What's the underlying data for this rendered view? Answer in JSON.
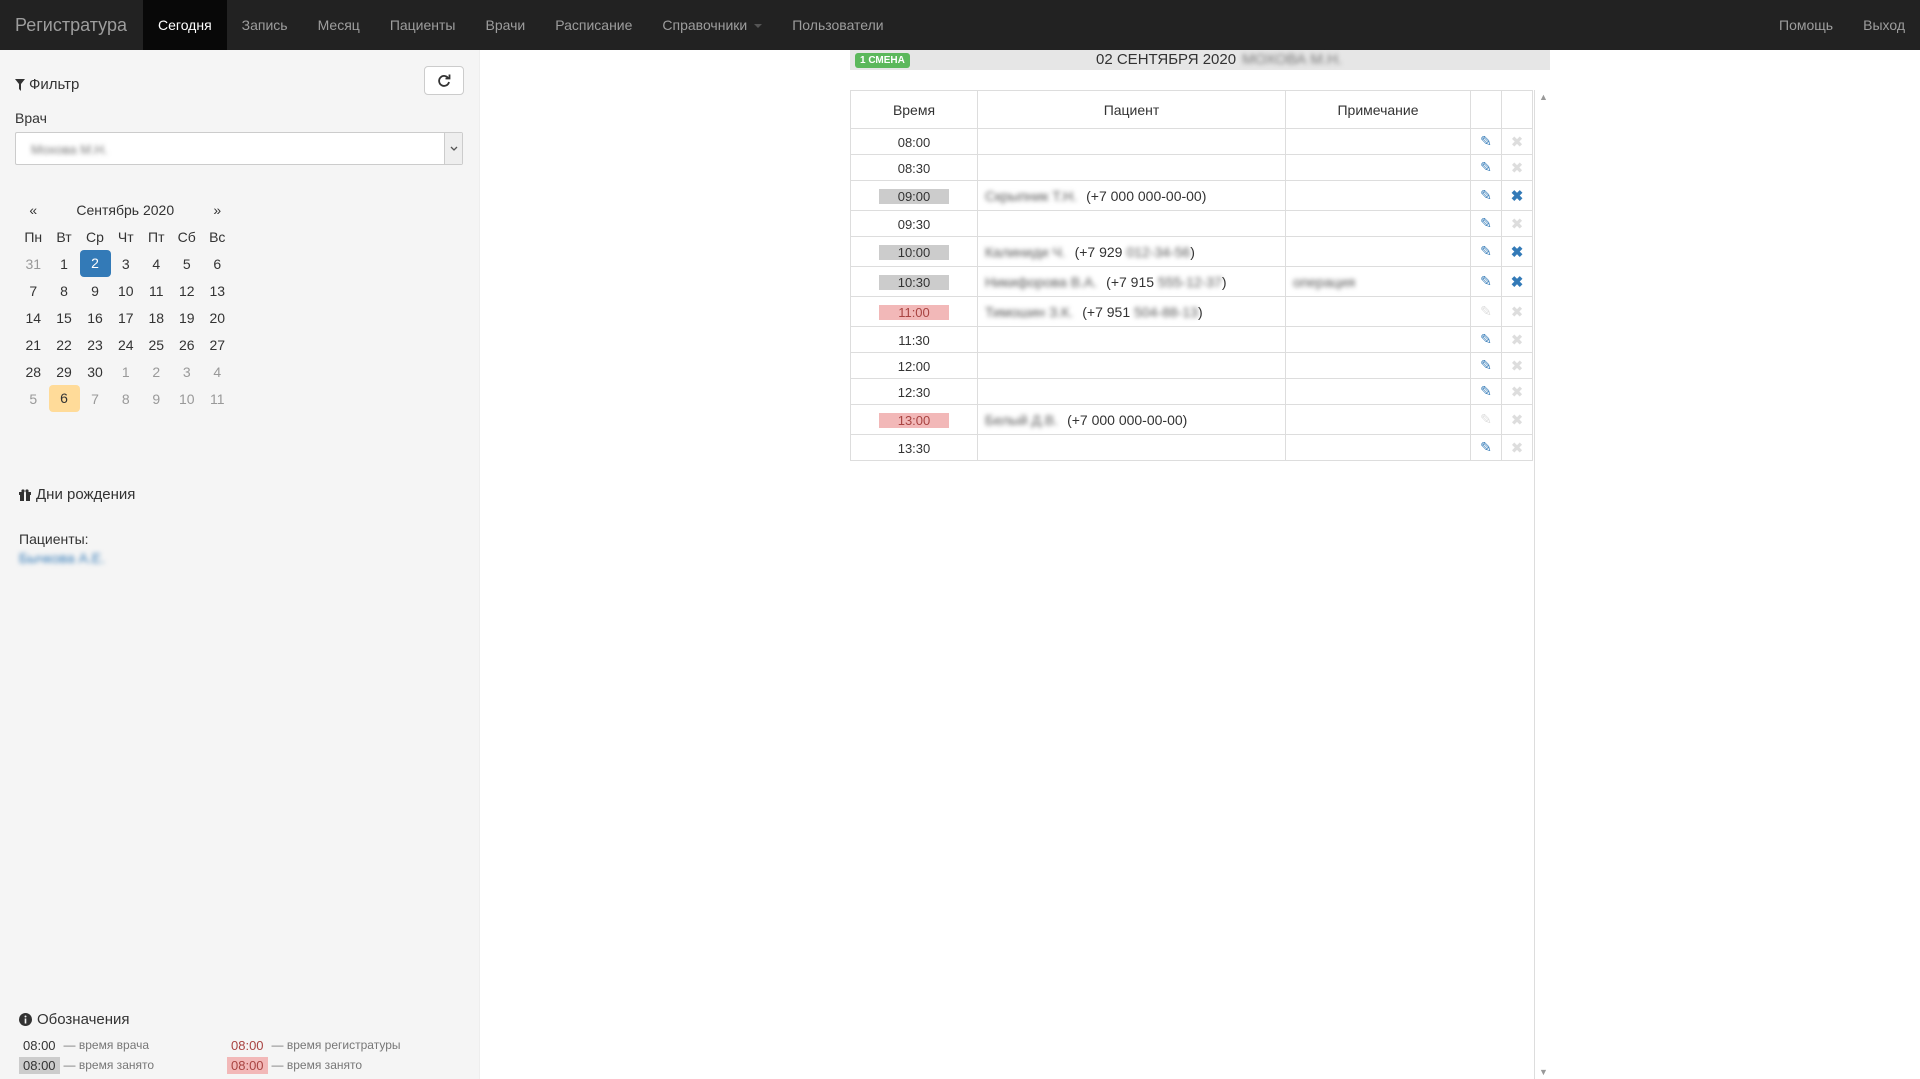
{
  "nav": {
    "brand": "Регистратура",
    "items": [
      "Сегодня",
      "Запись",
      "Месяц",
      "Пациенты",
      "Врачи",
      "Расписание",
      "Справочники",
      "Пользователи"
    ],
    "active": "Сегодня",
    "right": [
      "Помощь",
      "Выход"
    ]
  },
  "filter": {
    "title": "Фильтр",
    "doctor_label": "Врач",
    "doctor_value": "Мохова М.Н."
  },
  "calendar": {
    "prev": "«",
    "next": "»",
    "month_title": "Сентябрь 2020",
    "weekdays": [
      "Пн",
      "Вт",
      "Ср",
      "Чт",
      "Пт",
      "Сб",
      "Вс"
    ],
    "weeks": [
      [
        "31",
        "1",
        "2",
        "3",
        "4",
        "5",
        "6"
      ],
      [
        "7",
        "8",
        "9",
        "10",
        "11",
        "12",
        "13"
      ],
      [
        "14",
        "15",
        "16",
        "17",
        "18",
        "19",
        "20"
      ],
      [
        "21",
        "22",
        "23",
        "24",
        "25",
        "26",
        "27"
      ],
      [
        "28",
        "29",
        "30",
        "1",
        "2",
        "3",
        "4"
      ],
      [
        "5",
        "6",
        "7",
        "8",
        "9",
        "10",
        "11"
      ]
    ],
    "selected_day": "2",
    "today_day": "6"
  },
  "birthdays": {
    "title": "Дни рождения",
    "label": "Пациенты:",
    "patient": "Бычкова А.Е."
  },
  "legend": {
    "title": "Обозначения",
    "items": [
      {
        "time": "08:00",
        "text": "— время врача"
      },
      {
        "time": "08:00",
        "text": "— время регистратуры"
      },
      {
        "time": "08:00",
        "text": "— время занято"
      },
      {
        "time": "08:00",
        "text": "— время занято"
      }
    ]
  },
  "header": {
    "shift_badge": "1 СМЕНА",
    "date_title": "02 СЕНТЯБРЯ 2020",
    "doctor": "МОХОВА М.Н."
  },
  "schedule": {
    "columns": [
      "Время",
      "Пациент",
      "Примечание"
    ],
    "rows": [
      {
        "time": "08:00",
        "status": "free",
        "patient": "",
        "phone_prefix": "",
        "phone_rest": "",
        "note": "",
        "editable": true,
        "deletable": false
      },
      {
        "time": "08:30",
        "status": "free",
        "patient": "",
        "phone_prefix": "",
        "phone_rest": "",
        "note": "",
        "editable": true,
        "deletable": false
      },
      {
        "time": "09:00",
        "status": "busy",
        "patient": "Скрыпник Т.Н.",
        "phone_prefix": "(+7 000 000-00-00)",
        "phone_rest": "",
        "note": "",
        "editable": true,
        "deletable": true
      },
      {
        "time": "09:30",
        "status": "free",
        "patient": "",
        "phone_prefix": "",
        "phone_rest": "",
        "note": "",
        "editable": true,
        "deletable": false
      },
      {
        "time": "10:00",
        "status": "busy",
        "patient": "Калиниди Ч.",
        "phone_prefix": "(+7 929",
        "phone_rest": "012-34-56",
        "phone_suffix": ")",
        "note": "",
        "editable": true,
        "deletable": true
      },
      {
        "time": "10:30",
        "status": "busy",
        "patient": "Никифорова В.А.",
        "phone_prefix": "(+7 915",
        "phone_rest": "555-12-37",
        "phone_suffix": ")",
        "note": "операция",
        "editable": true,
        "deletable": true
      },
      {
        "time": "11:00",
        "status": "reg",
        "patient": "Тимошин З.К.",
        "phone_prefix": "(+7 951",
        "phone_rest": "504-88-13",
        "phone_suffix": ")",
        "note": "",
        "editable": false,
        "deletable": false
      },
      {
        "time": "11:30",
        "status": "free",
        "patient": "",
        "phone_prefix": "",
        "phone_rest": "",
        "note": "",
        "editable": true,
        "deletable": false
      },
      {
        "time": "12:00",
        "status": "free",
        "patient": "",
        "phone_prefix": "",
        "phone_rest": "",
        "note": "",
        "editable": true,
        "deletable": false
      },
      {
        "time": "12:30",
        "status": "free",
        "patient": "",
        "phone_prefix": "",
        "phone_rest": "",
        "note": "",
        "editable": true,
        "deletable": false
      },
      {
        "time": "13:00",
        "status": "reg",
        "patient": "Белый Д.В.",
        "phone_prefix": "(+7 000 000-00-00)",
        "phone_rest": "",
        "note": "",
        "editable": false,
        "deletable": false
      },
      {
        "time": "13:30",
        "status": "free",
        "patient": "",
        "phone_prefix": "",
        "phone_rest": "",
        "note": "",
        "editable": true,
        "deletable": false
      }
    ]
  },
  "colors": {
    "navbar": "#222222",
    "link": "#337ab7",
    "selected_day": "#337ab7",
    "today_day": "#ffdb99",
    "busy_time": "#cccccc",
    "reg_time": "#f2b8b8",
    "shift_badge": "#5cb85c"
  },
  "icons": {
    "filter": "filter-icon",
    "refresh": "refresh-icon",
    "gift": "gift-icon",
    "info": "info-circle-icon",
    "edit": "pencil-icon",
    "delete": "remove-icon"
  }
}
